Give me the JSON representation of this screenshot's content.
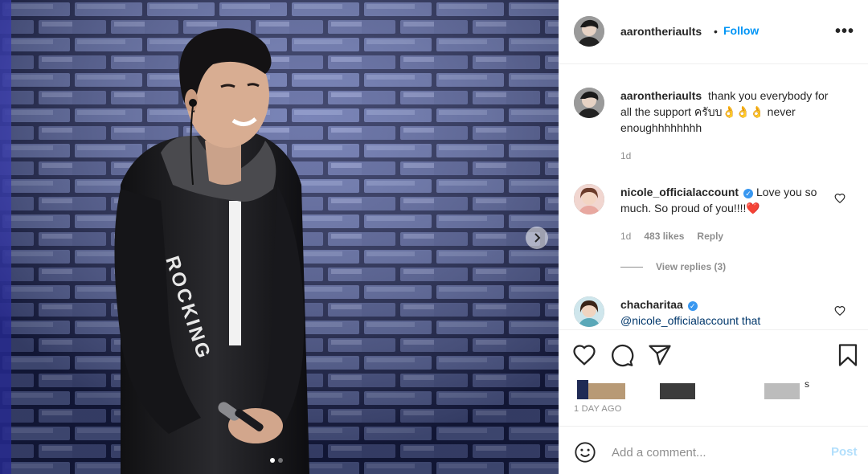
{
  "post": {
    "author": "aarontheriaults",
    "follow_label": "Follow",
    "separator": "•",
    "more_label": "•••",
    "carousel_dots": 2,
    "jacket_text": "ROCKING",
    "caption": {
      "username": "aarontheriaults",
      "text": "thank you everybody for all the support ครับบ👌👌👌 never enoughhhhhhhh",
      "time": "1d"
    },
    "comments": [
      {
        "username": "nicole_officialaccount",
        "verified": true,
        "text": "Love you so much. So proud of you!!!!❤️",
        "time": "1d",
        "likes": "483 likes",
        "reply_label": "Reply",
        "view_replies": "View replies (3)"
      },
      {
        "username": "chacharitaa",
        "verified": true,
        "text": "@nicole_officialaccount that"
      }
    ],
    "likes_partial": "s",
    "timestamp": "1 DAY AGO"
  },
  "composer": {
    "placeholder": "Add a comment...",
    "post_label": "Post"
  },
  "icons": [
    "heart-icon",
    "comment-icon",
    "share-icon",
    "bookmark-icon",
    "emoji-icon",
    "more-icon",
    "chevron-right-icon",
    "verified-badge-icon"
  ],
  "colors": {
    "accent": "#0095f6",
    "post_disabled": "#b2dffc",
    "muted_text": "#8e8e8e",
    "verified": "#3897f0"
  }
}
